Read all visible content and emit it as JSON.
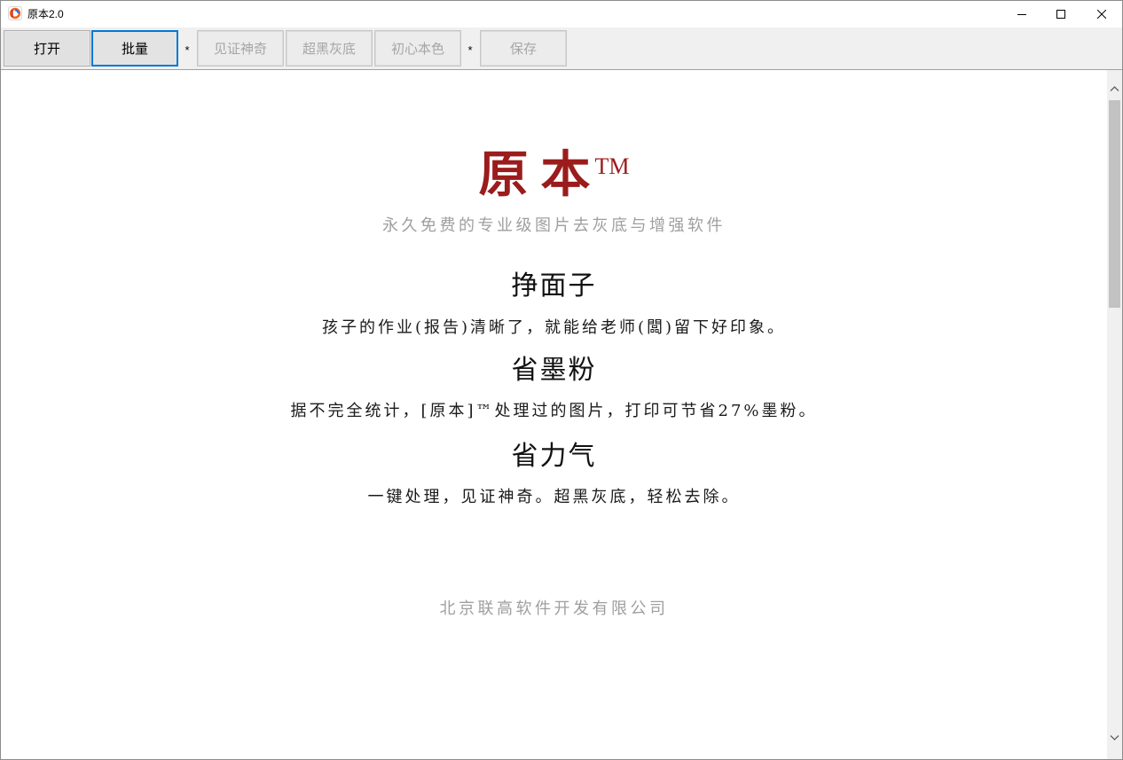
{
  "window": {
    "title": "原本2.0",
    "icon": "app-icon",
    "controls": {
      "minimize": "minimize-icon",
      "maximize": "maximize-icon",
      "close": "close-icon"
    }
  },
  "toolbar": {
    "buttons": [
      {
        "label": "打开",
        "enabled": true,
        "focused": false
      },
      {
        "label": "批量",
        "enabled": true,
        "focused": true
      },
      {
        "label": "见证神奇",
        "enabled": false,
        "focused": false
      },
      {
        "label": "超黑灰底",
        "enabled": false,
        "focused": false
      },
      {
        "label": "初心本色",
        "enabled": false,
        "focused": false
      },
      {
        "label": "保存",
        "enabled": false,
        "focused": false
      }
    ],
    "separators": [
      "*",
      "*"
    ]
  },
  "content": {
    "brand": "原本",
    "trademark": "TM",
    "tagline": "永久免费的专业级图片去灰底与增强软件",
    "sections": [
      {
        "heading": "挣面子",
        "text": "孩子的作业(报告)清晰了，就能给老师(闆)留下好印象。"
      },
      {
        "heading": "省墨粉",
        "text": "据不完全统计，[原本]™处理过的图片，打印可节省27%墨粉。"
      },
      {
        "heading": "省力气",
        "text": "一键处理，见证神奇。超黑灰底，轻松去除。"
      }
    ],
    "footer": "北京联高软件开发有限公司"
  },
  "scrollbar": {
    "scroll_position": 0,
    "visible_fraction": 0.33,
    "icons": {
      "up": "chevron-up-icon",
      "down": "chevron-down-icon"
    }
  },
  "colors": {
    "brand": "#9b1c1c",
    "muted": "#9f9f9f",
    "focus": "#0078d7"
  }
}
